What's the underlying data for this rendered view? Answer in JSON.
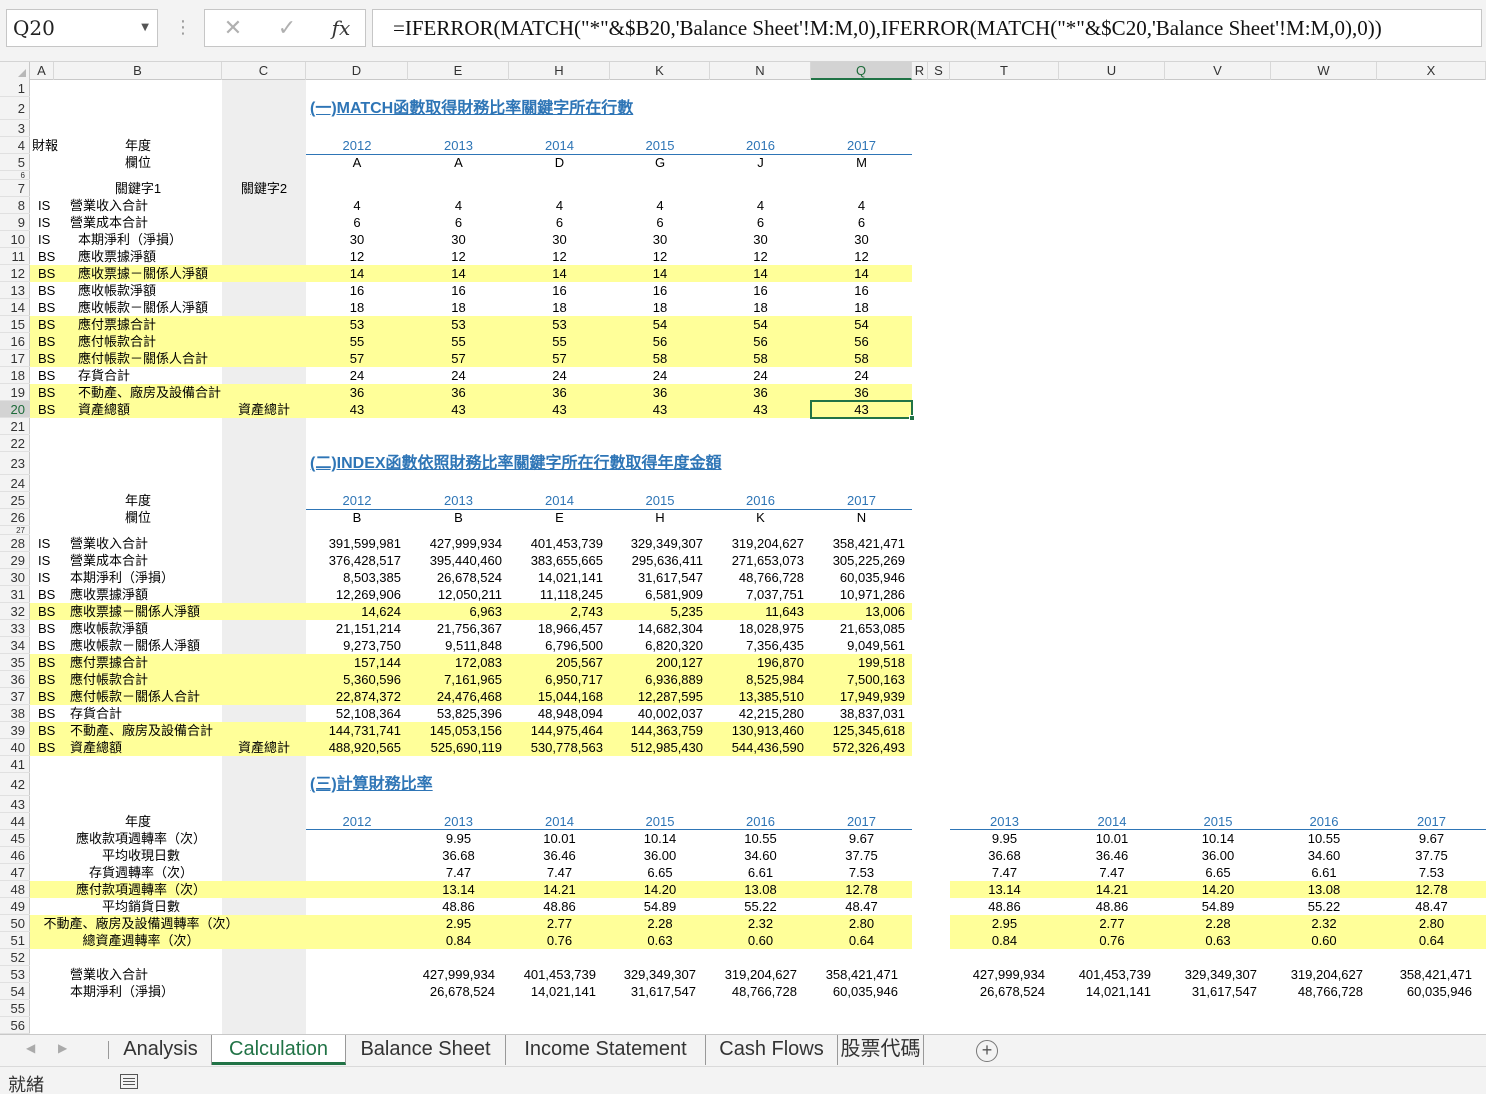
{
  "formula_bar": {
    "name_box": "Q20",
    "fx_label": "fx",
    "cancel_glyph": "✕",
    "enter_glyph": "✓",
    "formula": "=IFERROR(MATCH(\"*\"&$B20,'Balance Sheet'!M:M,0),IFERROR(MATCH(\"*\"&$C20,'Balance Sheet'!M:M,0),0))"
  },
  "columns": [
    "A",
    "B",
    "C",
    "D",
    "E",
    "H",
    "K",
    "N",
    "Q",
    "R",
    "S",
    "T",
    "U",
    "V",
    "W",
    "X"
  ],
  "selected_cell": {
    "col": "Q",
    "row": 20
  },
  "rows": [
    1,
    2,
    3,
    4,
    5,
    6,
    7,
    8,
    9,
    10,
    11,
    12,
    13,
    14,
    15,
    16,
    17,
    18,
    19,
    20,
    21,
    22,
    23,
    24,
    25,
    26,
    27,
    28,
    29,
    30,
    31,
    32,
    33,
    34,
    35,
    36,
    37,
    38,
    39,
    40,
    41,
    42,
    43,
    44,
    45,
    46,
    47,
    48,
    49,
    50,
    51,
    52,
    53,
    54,
    55,
    56
  ],
  "colors": {
    "accent": "#2e75b6",
    "highlight": "#ffff99",
    "selection": "#217346",
    "gray_column": "#eeeeee"
  },
  "section1": {
    "title": "(一)MATCH函數取得財務比率關鍵字所在行數",
    "fin_report_label": "財報",
    "year_label": "年度",
    "field_label": "欄位",
    "key1_label": "關鍵字1",
    "key2_label": "關鍵字2",
    "years": [
      "2012",
      "2013",
      "2014",
      "2015",
      "2016",
      "2017"
    ],
    "fields": [
      "A",
      "A",
      "D",
      "G",
      "J",
      "M"
    ],
    "rows": [
      {
        "row": 8,
        "type": "IS",
        "name": "營業收入合計",
        "key2": "",
        "values": [
          "4",
          "4",
          "4",
          "4",
          "4",
          "4"
        ],
        "hl": false
      },
      {
        "row": 9,
        "type": "IS",
        "name": "營業成本合計",
        "key2": "",
        "values": [
          "6",
          "6",
          "6",
          "6",
          "6",
          "6"
        ],
        "hl": false
      },
      {
        "row": 10,
        "type": "IS",
        "name": "本期淨利（淨損）",
        "key2": "",
        "values": [
          "30",
          "30",
          "30",
          "30",
          "30",
          "30"
        ],
        "hl": false
      },
      {
        "row": 11,
        "type": "BS",
        "name": "應收票據淨額",
        "key2": "",
        "values": [
          "12",
          "12",
          "12",
          "12",
          "12",
          "12"
        ],
        "hl": false
      },
      {
        "row": 12,
        "type": "BS",
        "name": "應收票據－關係人淨額",
        "key2": "",
        "values": [
          "14",
          "14",
          "14",
          "14",
          "14",
          "14"
        ],
        "hl": true
      },
      {
        "row": 13,
        "type": "BS",
        "name": "應收帳款淨額",
        "key2": "",
        "values": [
          "16",
          "16",
          "16",
          "16",
          "16",
          "16"
        ],
        "hl": false
      },
      {
        "row": 14,
        "type": "BS",
        "name": "應收帳款－關係人淨額",
        "key2": "",
        "values": [
          "18",
          "18",
          "18",
          "18",
          "18",
          "18"
        ],
        "hl": false
      },
      {
        "row": 15,
        "type": "BS",
        "name": "應付票據合計",
        "key2": "",
        "values": [
          "53",
          "53",
          "53",
          "54",
          "54",
          "54"
        ],
        "hl": true
      },
      {
        "row": 16,
        "type": "BS",
        "name": "應付帳款合計",
        "key2": "",
        "values": [
          "55",
          "55",
          "55",
          "56",
          "56",
          "56"
        ],
        "hl": true
      },
      {
        "row": 17,
        "type": "BS",
        "name": "應付帳款－關係人合計",
        "key2": "",
        "values": [
          "57",
          "57",
          "57",
          "58",
          "58",
          "58"
        ],
        "hl": true
      },
      {
        "row": 18,
        "type": "BS",
        "name": "存貨合計",
        "key2": "",
        "values": [
          "24",
          "24",
          "24",
          "24",
          "24",
          "24"
        ],
        "hl": false
      },
      {
        "row": 19,
        "type": "BS",
        "name": "不動產、廠房及設備合計",
        "key2": "",
        "values": [
          "36",
          "36",
          "36",
          "36",
          "36",
          "36"
        ],
        "hl": true
      },
      {
        "row": 20,
        "type": "BS",
        "name": "資產總額",
        "key2": "資產總計",
        "values": [
          "43",
          "43",
          "43",
          "43",
          "43",
          "43"
        ],
        "hl": true
      }
    ]
  },
  "section2": {
    "title": "(二)INDEX函數依照財務比率關鍵字所在行數取得年度金額",
    "year_label": "年度",
    "field_label": "欄位",
    "years": [
      "2012",
      "2013",
      "2014",
      "2015",
      "2016",
      "2017"
    ],
    "fields": [
      "B",
      "B",
      "E",
      "H",
      "K",
      "N"
    ],
    "rows": [
      {
        "row": 28,
        "type": "IS",
        "name": "營業收入合計",
        "key2": "",
        "values": [
          "391,599,981",
          "427,999,934",
          "401,453,739",
          "329,349,307",
          "319,204,627",
          "358,421,471"
        ],
        "hl": false
      },
      {
        "row": 29,
        "type": "IS",
        "name": "營業成本合計",
        "key2": "",
        "values": [
          "376,428,517",
          "395,440,460",
          "383,655,665",
          "295,636,411",
          "271,653,073",
          "305,225,269"
        ],
        "hl": false
      },
      {
        "row": 30,
        "type": "IS",
        "name": "本期淨利（淨損）",
        "key2": "",
        "values": [
          "8,503,385",
          "26,678,524",
          "14,021,141",
          "31,617,547",
          "48,766,728",
          "60,035,946"
        ],
        "hl": false
      },
      {
        "row": 31,
        "type": "BS",
        "name": "應收票據淨額",
        "key2": "",
        "values": [
          "12,269,906",
          "12,050,211",
          "11,118,245",
          "6,581,909",
          "7,037,751",
          "10,971,286"
        ],
        "hl": false
      },
      {
        "row": 32,
        "type": "BS",
        "name": "應收票據－關係人淨額",
        "key2": "",
        "values": [
          "14,624",
          "6,963",
          "2,743",
          "5,235",
          "11,643",
          "13,006"
        ],
        "hl": true
      },
      {
        "row": 33,
        "type": "BS",
        "name": "應收帳款淨額",
        "key2": "",
        "values": [
          "21,151,214",
          "21,756,367",
          "18,966,457",
          "14,682,304",
          "18,028,975",
          "21,653,085"
        ],
        "hl": false
      },
      {
        "row": 34,
        "type": "BS",
        "name": "應收帳款－關係人淨額",
        "key2": "",
        "values": [
          "9,273,750",
          "9,511,848",
          "6,796,500",
          "6,820,320",
          "7,356,435",
          "9,049,561"
        ],
        "hl": false
      },
      {
        "row": 35,
        "type": "BS",
        "name": "應付票據合計",
        "key2": "",
        "values": [
          "157,144",
          "172,083",
          "205,567",
          "200,127",
          "196,870",
          "199,518"
        ],
        "hl": true
      },
      {
        "row": 36,
        "type": "BS",
        "name": "應付帳款合計",
        "key2": "",
        "values": [
          "5,360,596",
          "7,161,965",
          "6,950,717",
          "6,936,889",
          "8,525,984",
          "7,500,163"
        ],
        "hl": true
      },
      {
        "row": 37,
        "type": "BS",
        "name": "應付帳款－關係人合計",
        "key2": "",
        "values": [
          "22,874,372",
          "24,476,468",
          "15,044,168",
          "12,287,595",
          "13,385,510",
          "17,949,939"
        ],
        "hl": true
      },
      {
        "row": 38,
        "type": "BS",
        "name": "存貨合計",
        "key2": "",
        "values": [
          "52,108,364",
          "53,825,396",
          "48,948,094",
          "40,002,037",
          "42,215,280",
          "38,837,031"
        ],
        "hl": false
      },
      {
        "row": 39,
        "type": "BS",
        "name": "不動產、廠房及設備合計",
        "key2": "",
        "values": [
          "144,731,741",
          "145,053,156",
          "144,975,464",
          "144,363,759",
          "130,913,460",
          "125,345,618"
        ],
        "hl": true
      },
      {
        "row": 40,
        "type": "BS",
        "name": "資產總額",
        "key2": "資產總計",
        "values": [
          "488,920,565",
          "525,690,119",
          "530,778,563",
          "512,985,430",
          "544,436,590",
          "572,326,493"
        ],
        "hl": true
      }
    ]
  },
  "section3": {
    "title": "(三)計算財務比率",
    "year_label": "年度",
    "years": [
      "2012",
      "2013",
      "2014",
      "2015",
      "2016",
      "2017"
    ],
    "years_right": [
      "2013",
      "2014",
      "2015",
      "2016",
      "2017"
    ],
    "rows": [
      {
        "row": 45,
        "name": "應收款項週轉率（次）",
        "values": [
          "",
          "9.95",
          "10.01",
          "10.14",
          "10.55",
          "9.67"
        ],
        "right": [
          "9.95",
          "10.01",
          "10.14",
          "10.55",
          "9.67"
        ],
        "hl": false
      },
      {
        "row": 46,
        "name": "平均收現日數",
        "values": [
          "",
          "36.68",
          "36.46",
          "36.00",
          "34.60",
          "37.75"
        ],
        "right": [
          "36.68",
          "36.46",
          "36.00",
          "34.60",
          "37.75"
        ],
        "hl": false
      },
      {
        "row": 47,
        "name": "存貨週轉率（次）",
        "values": [
          "",
          "7.47",
          "7.47",
          "6.65",
          "6.61",
          "7.53"
        ],
        "right": [
          "7.47",
          "7.47",
          "6.65",
          "6.61",
          "7.53"
        ],
        "hl": false
      },
      {
        "row": 48,
        "name": "應付款項週轉率（次）",
        "values": [
          "",
          "13.14",
          "14.21",
          "14.20",
          "13.08",
          "12.78"
        ],
        "right": [
          "13.14",
          "14.21",
          "14.20",
          "13.08",
          "12.78"
        ],
        "hl": true
      },
      {
        "row": 49,
        "name": "平均銷貨日數",
        "values": [
          "",
          "48.86",
          "48.86",
          "54.89",
          "55.22",
          "48.47"
        ],
        "right": [
          "48.86",
          "48.86",
          "54.89",
          "55.22",
          "48.47"
        ],
        "hl": false
      },
      {
        "row": 50,
        "name": "不動產、廠房及設備週轉率（次）",
        "values": [
          "",
          "2.95",
          "2.77",
          "2.28",
          "2.32",
          "2.80"
        ],
        "right": [
          "2.95",
          "2.77",
          "2.28",
          "2.32",
          "2.80"
        ],
        "hl": true
      },
      {
        "row": 51,
        "name": "總資產週轉率（次）",
        "values": [
          "",
          "0.84",
          "0.76",
          "0.63",
          "0.60",
          "0.64"
        ],
        "right": [
          "0.84",
          "0.76",
          "0.63",
          "0.60",
          "0.64"
        ],
        "hl": true
      }
    ],
    "extra_rows": [
      {
        "row": 53,
        "name": "營業收入合計",
        "values": [
          "",
          "427,999,934",
          "401,453,739",
          "329,349,307",
          "319,204,627",
          "358,421,471"
        ],
        "right": [
          "427,999,934",
          "401,453,739",
          "329,349,307",
          "319,204,627",
          "358,421,471"
        ]
      },
      {
        "row": 54,
        "name": "本期淨利（淨損）",
        "values": [
          "",
          "26,678,524",
          "14,021,141",
          "31,617,547",
          "48,766,728",
          "60,035,946"
        ],
        "right": [
          "26,678,524",
          "14,021,141",
          "31,617,547",
          "48,766,728",
          "60,035,946"
        ]
      }
    ]
  },
  "sheet_tabs": [
    {
      "label": "Analysis",
      "active": false
    },
    {
      "label": "Calculation",
      "active": true
    },
    {
      "label": "Balance Sheet",
      "active": false
    },
    {
      "label": "Income Statement",
      "active": false
    },
    {
      "label": "Cash Flows",
      "active": false
    },
    {
      "label": "股票代碼",
      "active": false
    }
  ],
  "status_bar": {
    "text": "就緒"
  }
}
